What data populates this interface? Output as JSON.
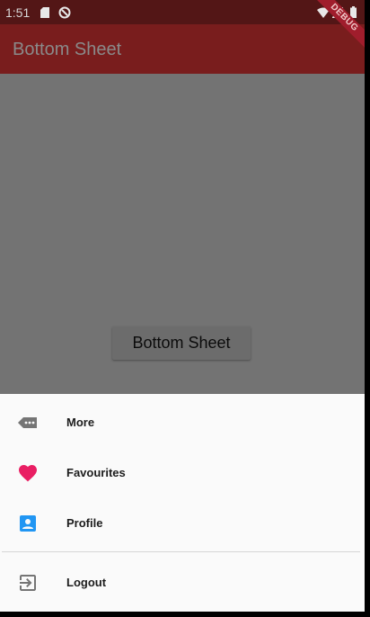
{
  "status_bar": {
    "time": "1:51",
    "icons": [
      "sd-card-icon",
      "no-sync-icon",
      "wifi-icon",
      "signal-icon",
      "battery-icon"
    ]
  },
  "app_bar": {
    "title": "Bottom Sheet"
  },
  "debug_banner": {
    "label": "DEBUG"
  },
  "main": {
    "button_label": "Bottom Sheet"
  },
  "bottom_sheet": {
    "items": [
      {
        "label": "More",
        "icon": "label-dots-icon",
        "icon_color": "#757575"
      },
      {
        "label": "Favourites",
        "icon": "heart-icon",
        "icon_color": "#e91e63"
      },
      {
        "label": "Profile",
        "icon": "account-box-icon",
        "icon_color": "#2196f3"
      },
      {
        "label": "Logout",
        "icon": "exit-icon",
        "icon_color": "#757575"
      }
    ]
  },
  "colors": {
    "status_bar": "#531616",
    "app_bar": "#791d1d",
    "scrim": "#737373",
    "sheet_bg": "#fafafa"
  }
}
